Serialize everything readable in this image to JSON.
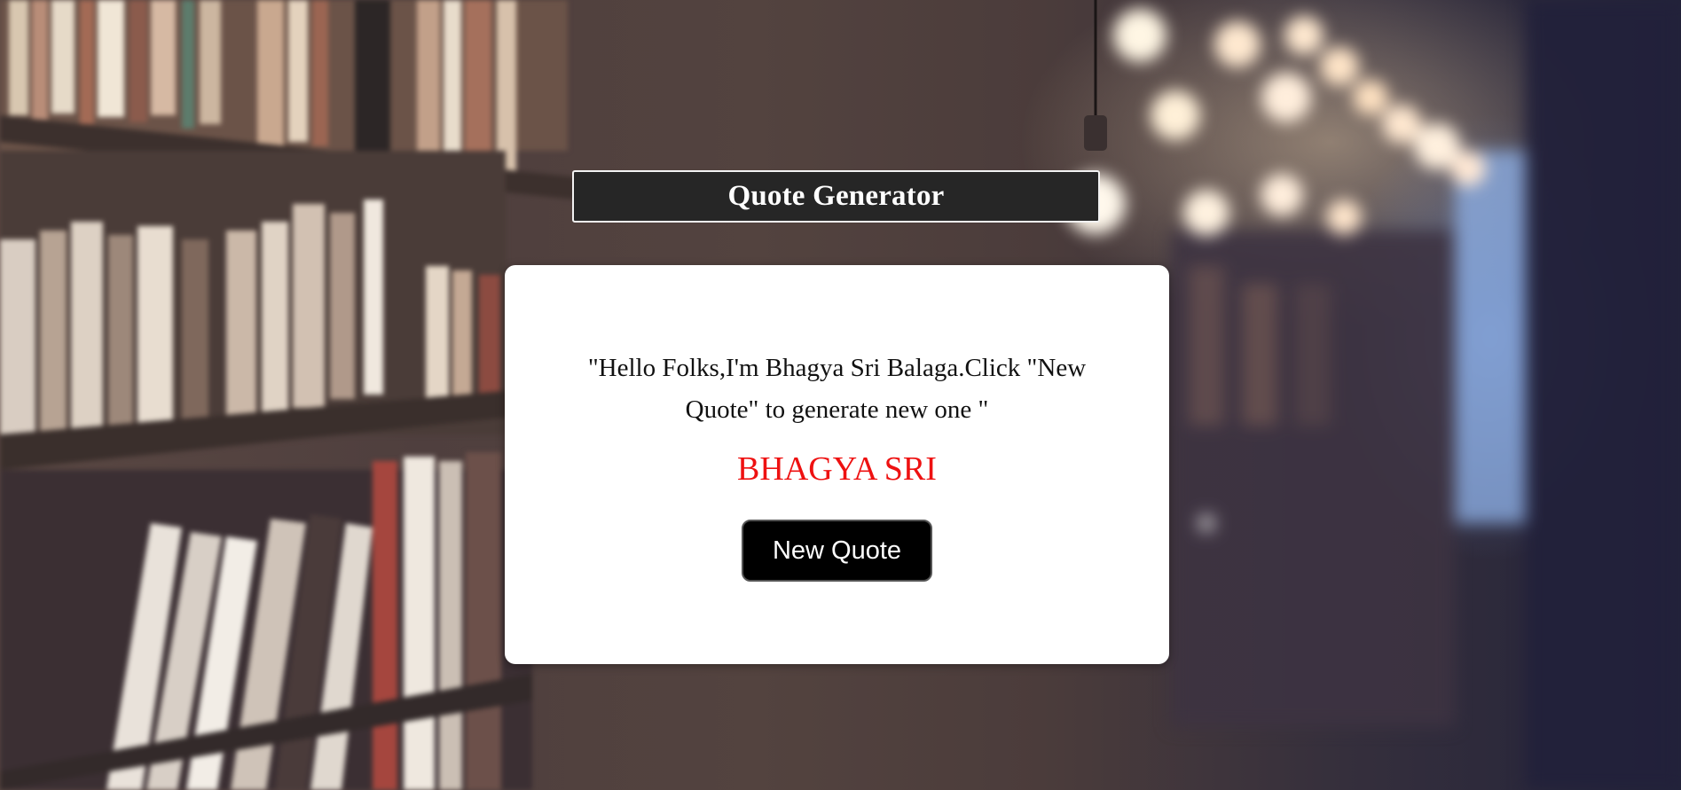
{
  "header": {
    "title": "Quote Generator"
  },
  "quote_card": {
    "quote": "\"Hello Folks,I'm Bhagya Sri Balaga.Click \"New Quote\" to generate new one \"",
    "author": "BHAGYA SRI",
    "button_label": "New Quote"
  },
  "colors": {
    "title_bar_bg": "#262626",
    "card_bg": "#ffffff",
    "author_color": "#ee1111",
    "button_bg": "#000000"
  },
  "background": {
    "description_icon": "library-bookshelf-background"
  }
}
